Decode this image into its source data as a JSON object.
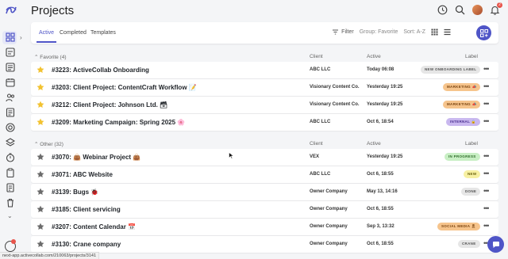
{
  "app": {
    "page_title": "Projects",
    "notification_count": "2"
  },
  "toolbar": {
    "tabs": [
      {
        "label": "Active"
      },
      {
        "label": "Completed"
      },
      {
        "label": "Templates"
      }
    ],
    "filter_label": "Filter",
    "group_label": "Group: Favorite",
    "sort_label": "Sort: A-Z"
  },
  "groups": [
    {
      "label": "Favorite (4)",
      "col_client": "Client",
      "col_active": "Active",
      "col_label": "Label"
    },
    {
      "label": "Other (32)",
      "col_client": "Client",
      "col_active": "Active",
      "col_label": "Label"
    }
  ],
  "favorite_rows": [
    {
      "title": "#3223: ActiveCollab Onboarding",
      "client": "ABC LLC",
      "active": "Today 06:08",
      "label": "NEW ONBOARDING LABEL",
      "label_bg": "#e6e6e6",
      "label_fg": "#555555",
      "starred": true
    },
    {
      "title": "#3203: Client Project: ContentCraft Workflow 📝",
      "client": "Visionary Content Co.",
      "active": "Yesterday 19:25",
      "label": "MARKETING 📣",
      "label_bg": "#f6c48c",
      "label_fg": "#7a4410",
      "starred": true
    },
    {
      "title": "#3212: Client Project: Johnson Ltd. 🗃",
      "client": "Visionary Content Co.",
      "active": "Yesterday 19:25",
      "label": "MARKETING 📣",
      "label_bg": "#f6c48c",
      "label_fg": "#7a4410",
      "starred": true
    },
    {
      "title": "#3209: Marketing Campaign: Spring 2025 🌸",
      "client": "ABC LLC",
      "active": "Oct 6, 18:54",
      "label": "INTERNAL 🔒",
      "label_bg": "#c9b8ef",
      "label_fg": "#4a2f8f",
      "starred": true
    }
  ],
  "other_rows": [
    {
      "title": "#3070: 👜 Webinar Project 👜",
      "client": "VEX",
      "active": "Yesterday 19:25",
      "label": "IN PROGRESS",
      "label_bg": "#c8efc4",
      "label_fg": "#2d6b27",
      "starred": false
    },
    {
      "title": "#3071: ABC Website",
      "client": "ABC LLC",
      "active": "Oct 6, 18:55",
      "label": "NEW",
      "label_bg": "#f7f0a2",
      "label_fg": "#6b6210",
      "starred": false
    },
    {
      "title": "#3139: Bugs 🐞",
      "client": "Owner Company",
      "active": "May 13, 14:16",
      "label": "DONE",
      "label_bg": "#e6e6e6",
      "label_fg": "#555555",
      "starred": false
    },
    {
      "title": "#3185: Client servicing",
      "client": "Owner Company",
      "active": "Oct 6, 18:55",
      "label": "",
      "label_bg": "",
      "label_fg": "",
      "starred": false
    },
    {
      "title": "#3207: Content Calendar 📅",
      "client": "Owner Company",
      "active": "Sep 3, 13:32",
      "label": "SOCIAL MEDIA 🎗",
      "label_bg": "#f6c48c",
      "label_fg": "#7a4410",
      "starred": false
    },
    {
      "title": "#3130: Crane company",
      "client": "Owner Company",
      "active": "Oct 6, 18:55",
      "label": "CRANE",
      "label_bg": "#e6e6e6",
      "label_fg": "#555555",
      "starred": false
    }
  ],
  "status_url": "next-app.activecollab.com/210063/projects/3141",
  "colors": {
    "accent": "#4f55c7",
    "star_on": "#f2c230",
    "star_off": "#6b6b6b"
  },
  "icons": {
    "rail": [
      "projects-grid-icon",
      "tasks-icon",
      "calendar-list-icon",
      "calendar-icon",
      "people-icon",
      "notes-icon",
      "target-icon",
      "layers-icon",
      "timer-icon",
      "clipboard-icon",
      "invoice-icon",
      "trash-icon"
    ],
    "top": [
      "clock-icon",
      "search-icon",
      "avatar",
      "bell-icon"
    ]
  }
}
